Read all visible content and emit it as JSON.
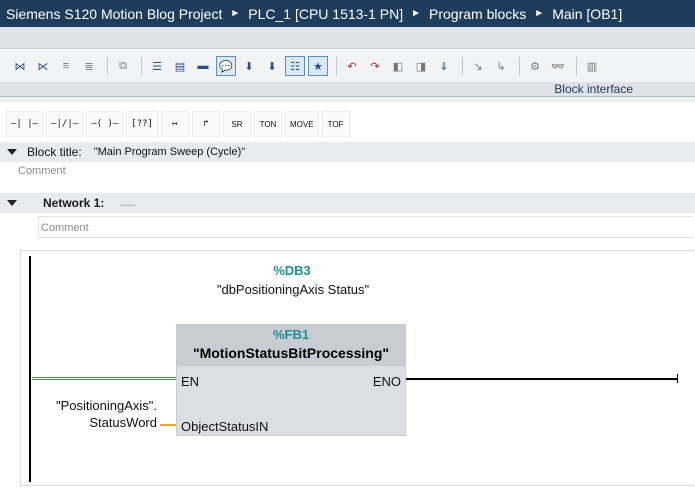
{
  "breadcrumb": {
    "project": "Siemens S120 Motion Blog Project",
    "plc": "PLC_1 [CPU 1513-1 PN]",
    "folder": "Program blocks",
    "block": "Main [OB1]"
  },
  "toolbar": {
    "icons": [
      "insert-network-icon",
      "delete-network-icon",
      "insert-row-icon",
      "add-row-icon",
      "compare-icon",
      "absolute-symbolic-icon",
      "show-favorites-icon",
      "program-status-icon",
      "comments-icon",
      "download-icon",
      "call-hierarchy-icon",
      "networks-overview-icon",
      "favorites-icon",
      "go-to-error-icon",
      "previous-error-icon",
      "monitor-icon",
      "compile-icon",
      "step-icon",
      "step-into-icon",
      "watch-icon",
      "block-settings-icon",
      "test-icon"
    ]
  },
  "interface": {
    "label": "Block interface"
  },
  "ladder_elements": [
    "normally-open-contact",
    "normally-closed-contact",
    "output-coil",
    "empty-box",
    "open-branch",
    "close-branch",
    "SR",
    "TON",
    "MOVE",
    "TOF"
  ],
  "block_title": {
    "label": "Block title:",
    "value": "\"Main Program Sweep (Cycle)\"",
    "comment_placeholder": "Comment"
  },
  "network": {
    "label": "Network 1:",
    "title_placeholder": ".....",
    "comment_placeholder": "Comment"
  },
  "ladder": {
    "instance_db_number": "%DB3",
    "instance_db_name": "\"dbPositioningAxis Status\"",
    "fb_number": "%FB1",
    "fb_name": "\"MotionStatusBitProcessing\"",
    "pin_en": "EN",
    "pin_eno": "ENO",
    "pin_param": "ObjectStatusIN",
    "param_operand": "\"PositioningAxis\". StatusWord"
  },
  "colors": {
    "title_bar": "#1e3c5c",
    "address_teal": "#1f8f95",
    "param_wire": "#e8a33a",
    "fb_box": "#dcdee3"
  }
}
